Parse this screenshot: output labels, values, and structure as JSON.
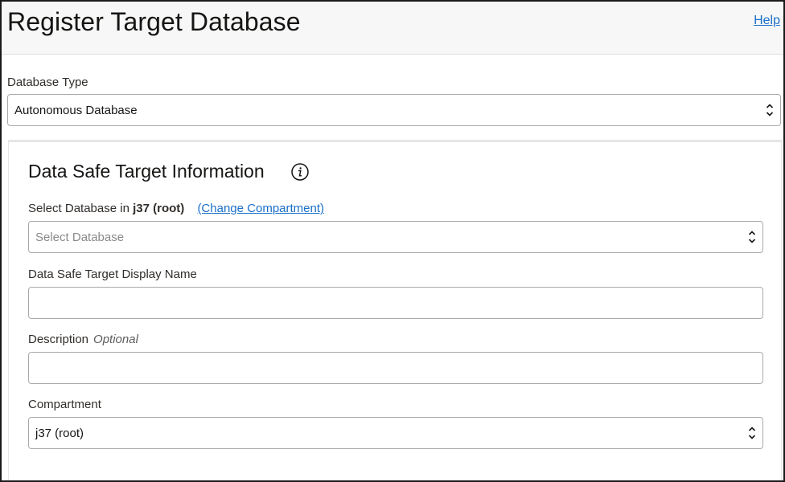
{
  "header": {
    "title": "Register Target Database",
    "help_label": "Help"
  },
  "database_type": {
    "label": "Database Type",
    "value": "Autonomous Database"
  },
  "target_info": {
    "section_title": "Data Safe Target Information",
    "info_icon": "info-icon",
    "select_db": {
      "label_prefix": "Select Database in",
      "compartment_name": "j37 (root)",
      "change_link": "(Change Compartment)",
      "placeholder": "Select Database"
    },
    "display_name": {
      "label": "Data Safe Target Display Name",
      "value": ""
    },
    "description": {
      "label": "Description",
      "optional_label": "Optional",
      "value": ""
    },
    "compartment": {
      "label": "Compartment",
      "value": "j37 (root)"
    }
  },
  "colors": {
    "link": "#1a6fc9",
    "text": "#312d2a",
    "border": "#a9a9a9"
  }
}
